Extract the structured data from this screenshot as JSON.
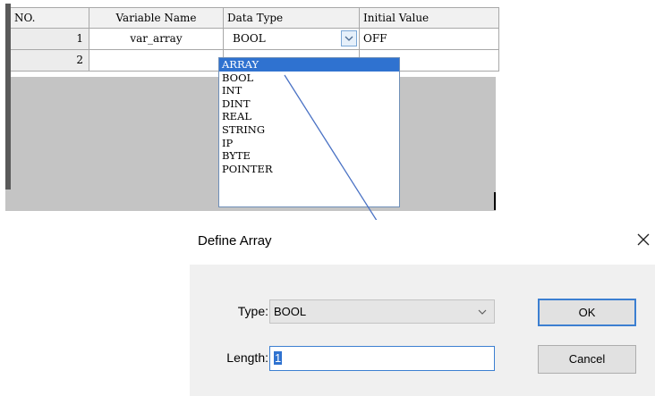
{
  "table": {
    "headers": [
      "NO.",
      "Variable Name",
      "Data Type",
      "Initial Value"
    ],
    "rows": [
      {
        "no": "1",
        "variable_name": "var_array",
        "data_type": "BOOL",
        "initial_value": "OFF"
      },
      {
        "no": "2",
        "variable_name": "",
        "data_type": "",
        "initial_value": ""
      }
    ]
  },
  "dropdown": {
    "options": [
      "ARRAY",
      "BOOL",
      "INT",
      "DINT",
      "REAL",
      "STRING",
      "IP",
      "BYTE",
      "POINTER"
    ],
    "highlighted": "ARRAY"
  },
  "dialog": {
    "title": "Define Array",
    "type_label": "Type:",
    "type_value": "BOOL",
    "length_label": "Length:",
    "length_value": "1",
    "ok_label": "OK",
    "cancel_label": "Cancel"
  },
  "colors": {
    "selection": "#2f72d0",
    "arrow": "#4a72c4",
    "focus_border": "#3c7fd1"
  },
  "icons": {
    "dropdown_chevron": "chevron-down-icon",
    "close": "close-icon"
  }
}
